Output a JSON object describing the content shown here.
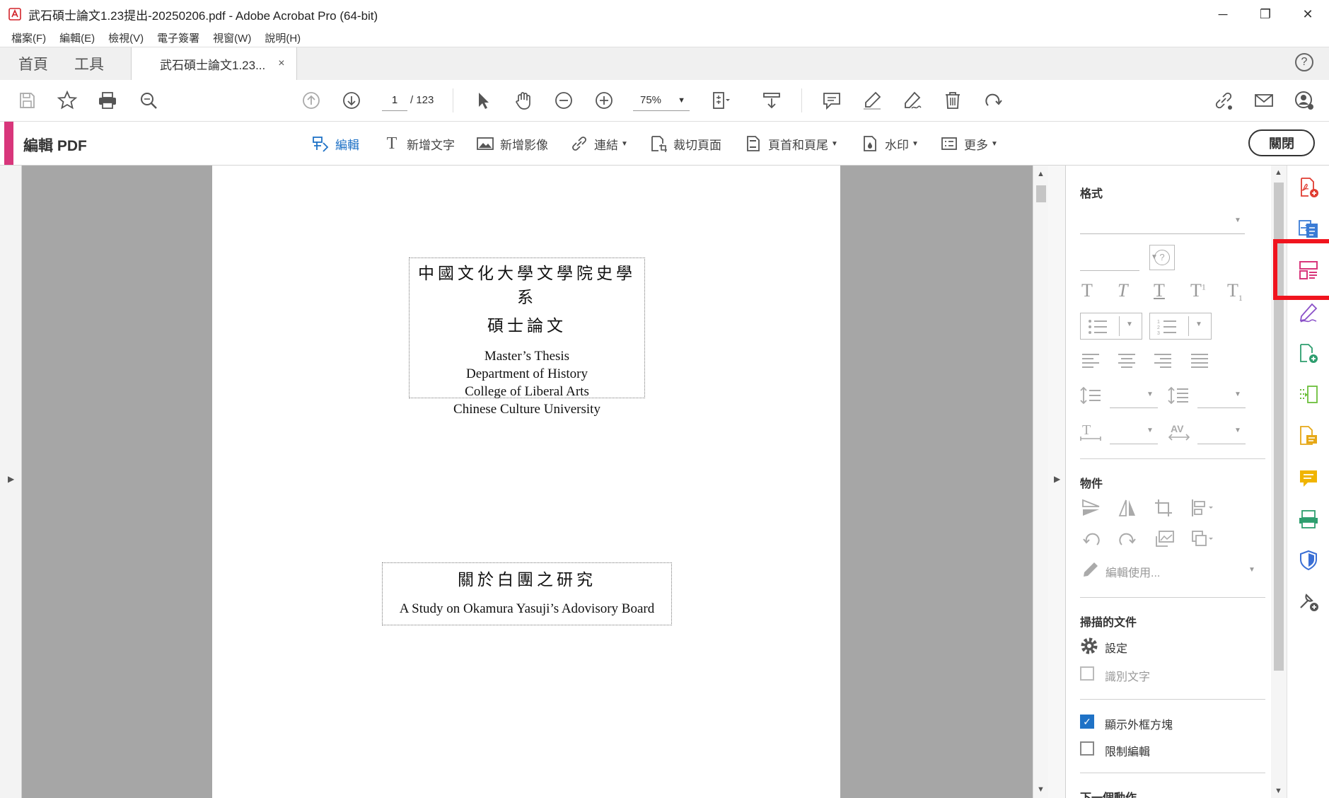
{
  "window": {
    "title": "武石碩士論文1.23提出-20250206.pdf - Adobe Acrobat Pro (64-bit)",
    "controls": {
      "minimize": "─",
      "restore": "❐",
      "close": "✕"
    }
  },
  "menu": [
    "檔案(F)",
    "編輯(E)",
    "檢視(V)",
    "電子簽署",
    "視窗(W)",
    "說明(H)"
  ],
  "tabs": {
    "home": "首頁",
    "tools": "工具",
    "document": "武石碩士論文1.23...",
    "close": "×",
    "help": "?"
  },
  "toolbar": {
    "page_current": "1",
    "page_total": "/ 123",
    "zoom": "75%"
  },
  "edit_toolbar": {
    "title": "編輯 PDF",
    "tools": {
      "edit": "編輯",
      "add_text": "新增文字",
      "add_image": "新增影像",
      "link": "連結",
      "crop": "裁切頁面",
      "header_footer": "頁首和頁尾",
      "watermark": "水印",
      "more": "更多"
    },
    "close": "關閉"
  },
  "document": {
    "block1": {
      "cn_line1": "中國文化大學文學院史學系",
      "cn_line2": "碩士論文",
      "en_line1": "Master’s Thesis",
      "en_line2": "Department of History",
      "en_line3": "College of Liberal Arts",
      "en_line4": "Chinese Culture University"
    },
    "block2": {
      "cn_title": "關於白團之研究",
      "en_title": "A Study on Okamura Yasuji’s Adovisory Board"
    }
  },
  "format_panel": {
    "format_header": "格式",
    "objects_header": "物件",
    "edit_using": "編輯使用...",
    "scanned_header": "掃描的文件",
    "settings": "設定",
    "recognize_text": "識別文字",
    "show_bounding_boxes": "顯示外框方塊",
    "show_bounding_boxes_checked": true,
    "restrict_editing": "限制編輯",
    "restrict_editing_checked": false,
    "next_action_header": "下一個動作"
  },
  "colors": {
    "accent_pink": "#d8367b",
    "highlight_red": "#f0141e",
    "active_blue": "#1f72c6"
  }
}
